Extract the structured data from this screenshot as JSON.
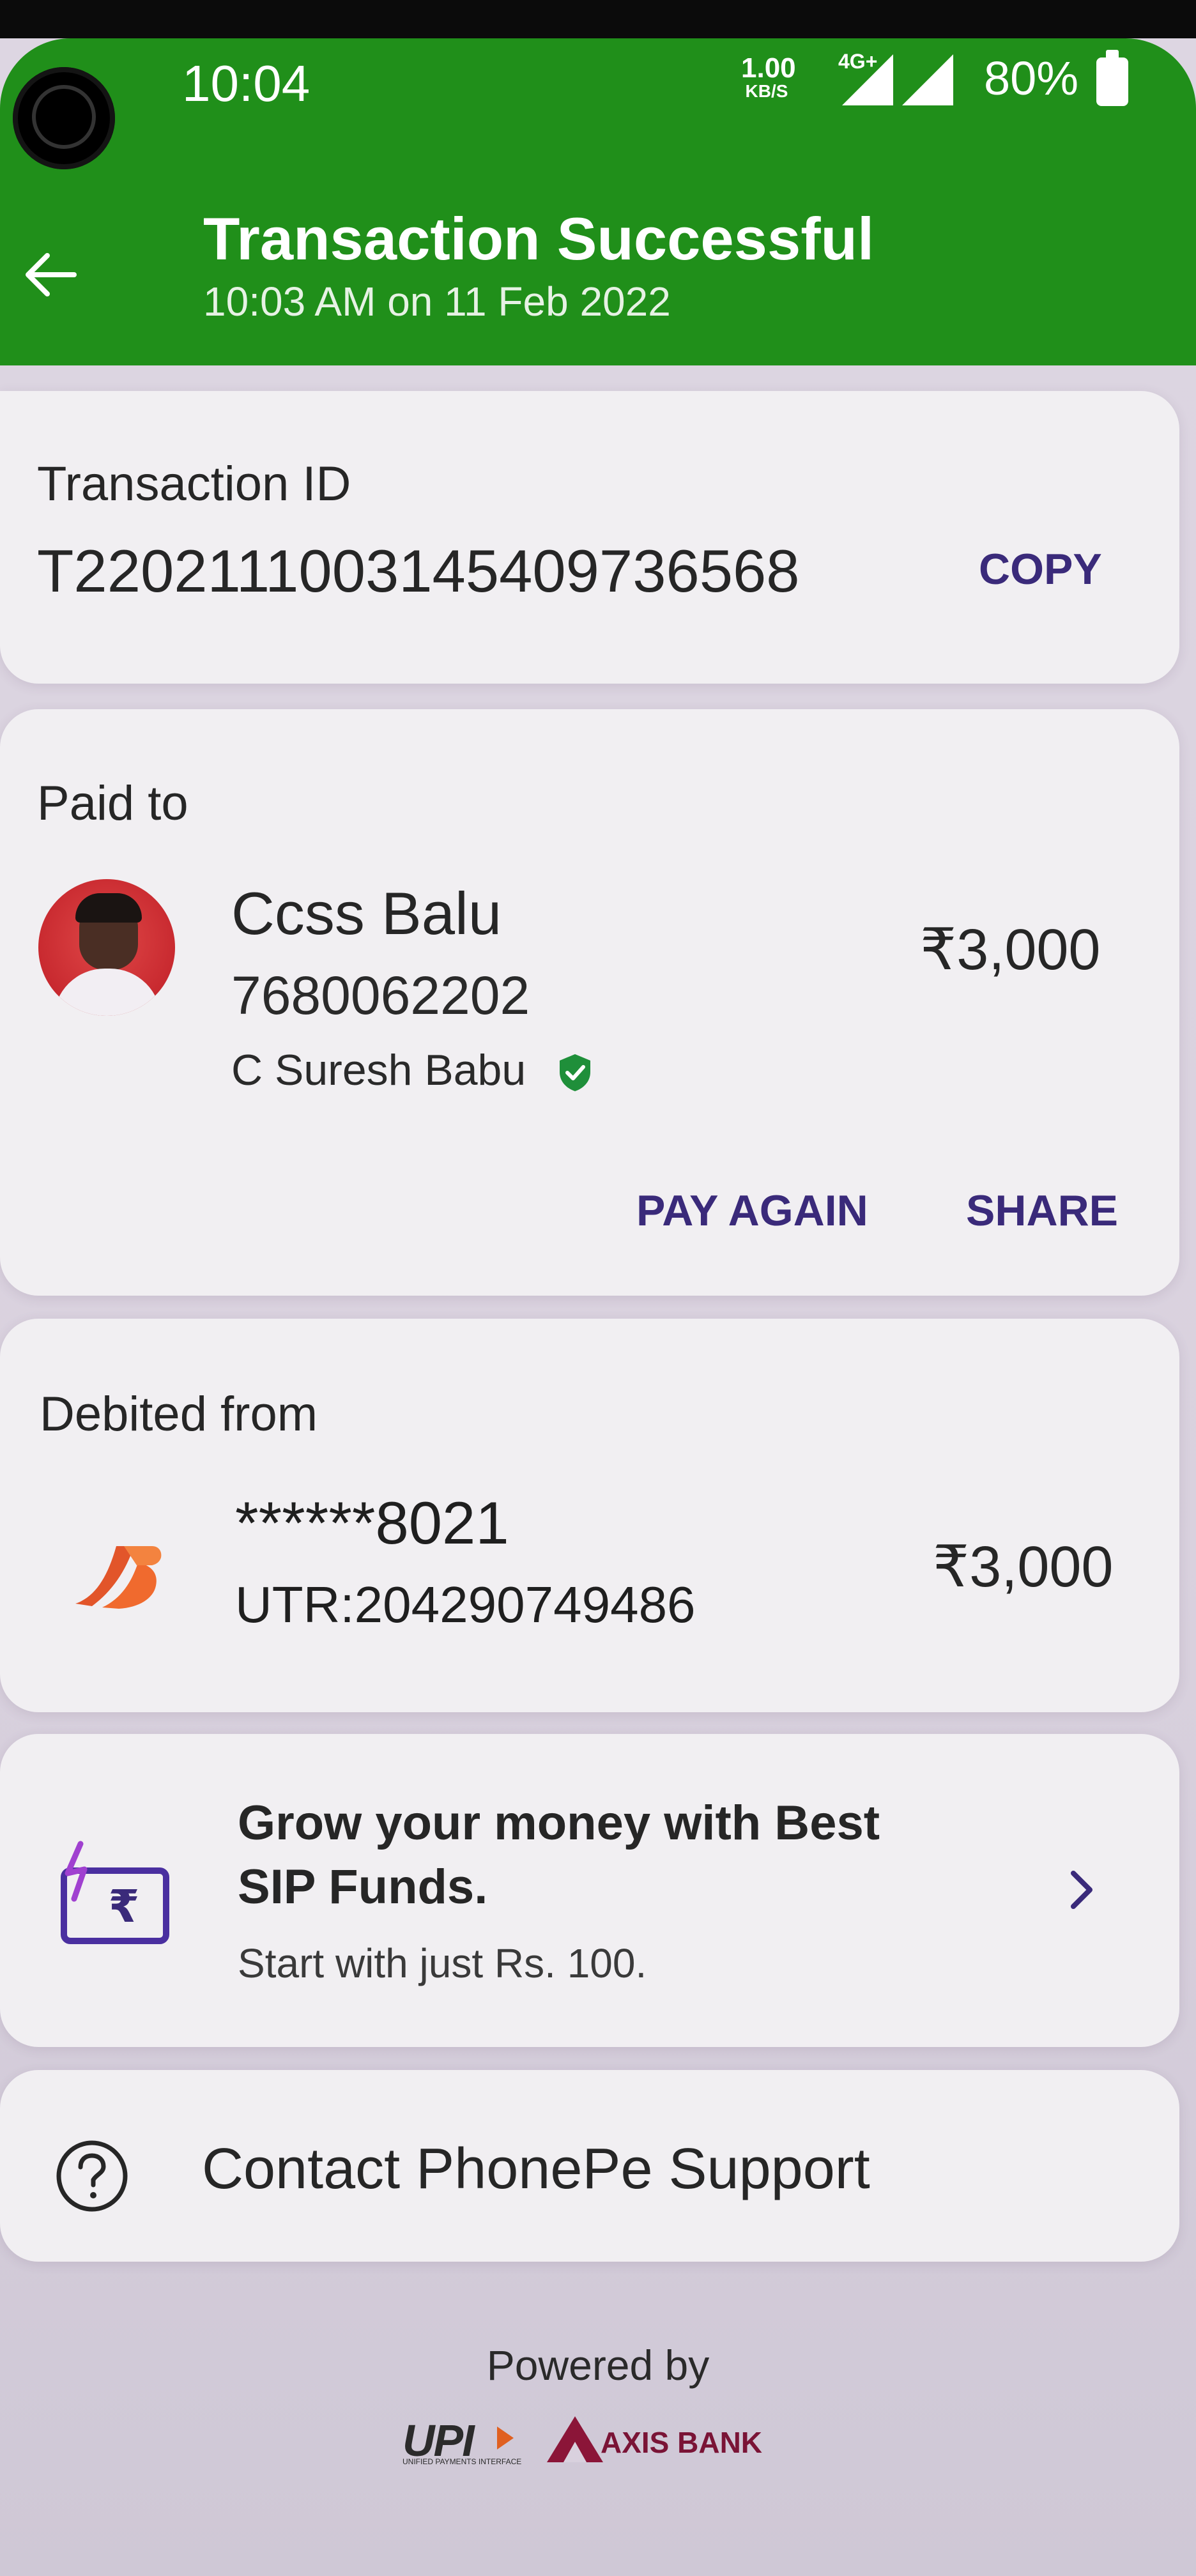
{
  "status_bar": {
    "time": "10:04",
    "net_speed": "1.00",
    "net_speed_unit": "KB/S",
    "network_type": "4G+",
    "battery": "80%"
  },
  "header": {
    "title": "Transaction Successful",
    "subtitle": "10:03 AM on 11 Feb 2022",
    "color": "#208f1a"
  },
  "transaction": {
    "label": "Transaction ID",
    "id": "T2202111003145409736568",
    "copy_label": "COPY"
  },
  "paid_to": {
    "label": "Paid to",
    "name": "Ccss Balu",
    "phone": "7680062202",
    "legal_name": "C Suresh Babu",
    "amount": "₹3,000",
    "pay_again_label": "PAY AGAIN",
    "share_label": "SHARE"
  },
  "debited_from": {
    "label": "Debited from",
    "account": "******8021",
    "utr": "UTR:204290749486",
    "amount": "₹3,000"
  },
  "promo": {
    "line1": "Grow your money with Best",
    "line2": "SIP Funds.",
    "sub": "Start with just Rs. 100."
  },
  "support": {
    "label": "Contact PhonePe Support"
  },
  "footer": {
    "powered_by": "Powered by",
    "upi": "UPI",
    "upi_sub": "UNIFIED PAYMENTS INTERFACE",
    "partner_bank": "AXIS BANK"
  },
  "accent_color": "#3a2a7a"
}
